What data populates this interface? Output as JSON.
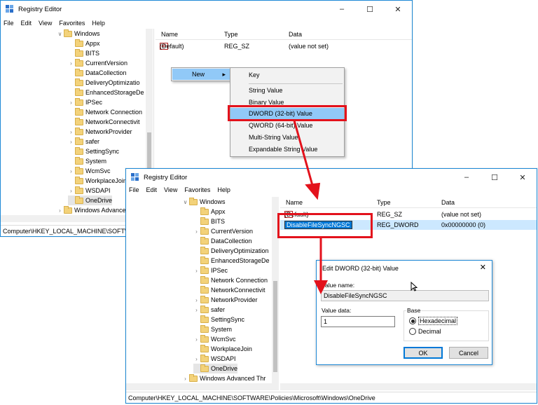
{
  "back_window": {
    "title": "Registry Editor",
    "menu": [
      "File",
      "Edit",
      "View",
      "Favorites",
      "Help"
    ],
    "tree": [
      {
        "label": "Windows",
        "expanded": true
      },
      {
        "label": "Appx"
      },
      {
        "label": "BITS"
      },
      {
        "label": "CurrentVersion"
      },
      {
        "label": "DataCollection"
      },
      {
        "label": "DeliveryOptimizatio"
      },
      {
        "label": "EnhancedStorageDe"
      },
      {
        "label": "IPSec"
      },
      {
        "label": "Network Connection"
      },
      {
        "label": "NetworkConnectivit"
      },
      {
        "label": "NetworkProvider"
      },
      {
        "label": "safer"
      },
      {
        "label": "SettingSync"
      },
      {
        "label": "System"
      },
      {
        "label": "WcmSvc"
      },
      {
        "label": "WorkplaceJoin"
      },
      {
        "label": "WSDAPI"
      },
      {
        "label": "OneDrive"
      },
      {
        "label": "Windows Advance"
      }
    ],
    "columns": [
      "Name",
      "Type",
      "Data"
    ],
    "rows": [
      {
        "name": "(Default)",
        "type": "REG_SZ",
        "data": "(value not set)"
      }
    ],
    "status": "Computer\\HKEY_LOCAL_MACHINE\\SOFTW"
  },
  "context_menu": {
    "new_label": "New",
    "submenu": [
      "Key",
      "String Value",
      "Binary Value",
      "DWORD (32-bit) Value",
      "QWORD (64-bit) Value",
      "Multi-String Value",
      "Expandable String Value"
    ]
  },
  "front_window": {
    "title": "Registry Editor",
    "menu": [
      "File",
      "Edit",
      "View",
      "Favorites",
      "Help"
    ],
    "tree": [
      {
        "label": "Windows"
      },
      {
        "label": "Appx"
      },
      {
        "label": "BITS"
      },
      {
        "label": "CurrentVersion"
      },
      {
        "label": "DataCollection"
      },
      {
        "label": "DeliveryOptimization"
      },
      {
        "label": "EnhancedStorageDe"
      },
      {
        "label": "IPSec"
      },
      {
        "label": "Network Connection"
      },
      {
        "label": "NetworkConnectivit"
      },
      {
        "label": "NetworkProvider"
      },
      {
        "label": "safer"
      },
      {
        "label": "SettingSync"
      },
      {
        "label": "System"
      },
      {
        "label": "WcmSvc"
      },
      {
        "label": "WorkplaceJoin"
      },
      {
        "label": "WSDAPI"
      },
      {
        "label": "OneDrive"
      },
      {
        "label": "Windows Advanced Thr"
      }
    ],
    "columns": [
      "Name",
      "Type",
      "Data"
    ],
    "rows": [
      {
        "name": "(Default)",
        "type": "REG_SZ",
        "data": "(value not set)"
      },
      {
        "name": "DisableFileSyncNGSC",
        "type": "REG_DWORD",
        "data": "0x00000000 (0)"
      }
    ],
    "status": "Computer\\HKEY_LOCAL_MACHINE\\SOFTWARE\\Policies\\Microsoft\\Windows\\OneDrive"
  },
  "dialog": {
    "title": "Edit DWORD (32-bit) Value",
    "value_name_label": "Value name:",
    "value_name": "DisableFileSyncNGSC",
    "value_data_label": "Value data:",
    "value_data": "1",
    "base_label": "Base",
    "base_hex": "Hexadecimal",
    "base_dec": "Decimal",
    "ok": "OK",
    "cancel": "Cancel"
  },
  "colors": {
    "accent": "#e3121c",
    "selection": "#cce8ff",
    "highlight": "#0078d7"
  }
}
